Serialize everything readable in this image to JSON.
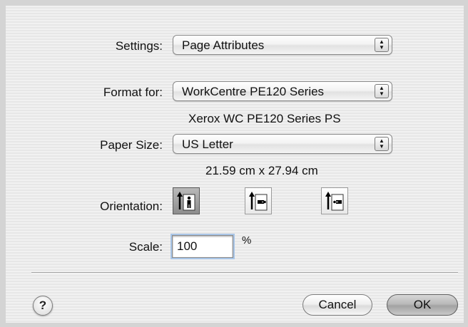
{
  "settings": {
    "label": "Settings:",
    "value": "Page Attributes"
  },
  "format_for": {
    "label": "Format for:",
    "value": "WorkCentre PE120 Series",
    "printer_description": "Xerox WC PE120 Series PS"
  },
  "paper_size": {
    "label": "Paper Size:",
    "value": "US Letter",
    "dimensions": "21.59 cm x 27.94 cm"
  },
  "orientation": {
    "label": "Orientation:",
    "options": [
      {
        "name": "portrait",
        "selected": true
      },
      {
        "name": "landscape-left",
        "selected": false
      },
      {
        "name": "landscape-right",
        "selected": false
      }
    ]
  },
  "scale": {
    "label": "Scale:",
    "value": "100",
    "unit": "%"
  },
  "buttons": {
    "help": "?",
    "cancel": "Cancel",
    "ok": "OK"
  },
  "icons": {
    "popup_arrows": "up-down-arrows-icon",
    "help": "question-mark-icon"
  }
}
